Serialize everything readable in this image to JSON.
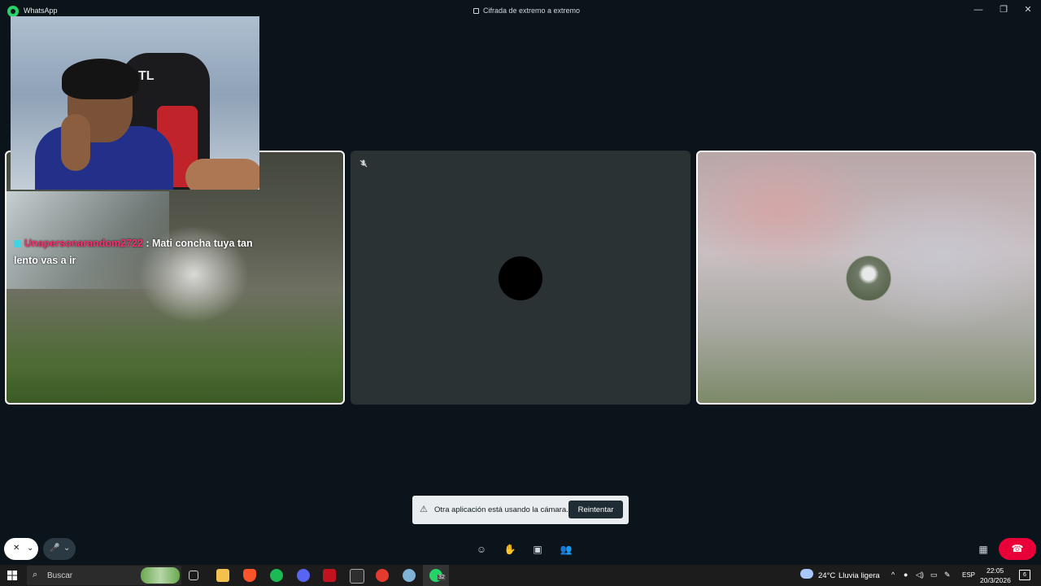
{
  "window": {
    "app_name": "WhatsApp",
    "encryption_label": "Cifrada de extremo a extremo",
    "min_glyph": "—",
    "restore_glyph": "❐",
    "close_glyph": "✕"
  },
  "tiles": {
    "stream_chat": {
      "username": "Unapersonarandom2722",
      "separator": " : ",
      "message": "Mati concha tuya tan lento vas a ir"
    }
  },
  "camera_toast": {
    "icon_glyph": "⚠",
    "message": "Otra aplicación está usando la cámara.",
    "retry_label": "Reintentar"
  },
  "call_controls": {
    "camera_glyph": "✕",
    "mic_glyph": "🎤",
    "chevron_glyph": "⌄",
    "emoji_glyph": "☺",
    "raise_hand_glyph": "✋",
    "screen_share_glyph": "▣",
    "participants_glyph": "👥",
    "layout_glyph": "▦",
    "end_call_glyph": "☎"
  },
  "taskbar": {
    "search_placeholder": "Buscar",
    "whatsapp_badge": "32",
    "weather": {
      "temperature": "24°C",
      "condition": "Lluvia ligera"
    },
    "language": "ESP",
    "time": "22:05",
    "date": "20/3/2026",
    "notification_count": "6"
  },
  "colors": {
    "background": "#0b141a",
    "end_call": "#ea0038",
    "whatsapp_green": "#25d366",
    "chat_username": "#ff2d6e"
  }
}
